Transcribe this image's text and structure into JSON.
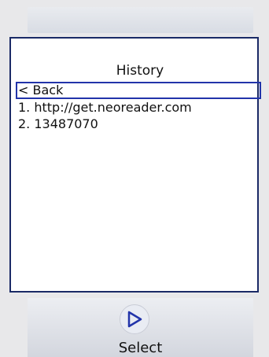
{
  "screen": {
    "title": "History",
    "items": [
      {
        "label": "< Back",
        "selected": true
      },
      {
        "label": "1. http://get.neoreader.com",
        "selected": false
      },
      {
        "label": "2. 13487070",
        "selected": false
      }
    ]
  },
  "softkey": {
    "icon": "play-triangle-icon",
    "label": "Select"
  },
  "colors": {
    "accent": "#2234aa",
    "frame": "#1a2a66",
    "background": "#e8e8ea"
  }
}
